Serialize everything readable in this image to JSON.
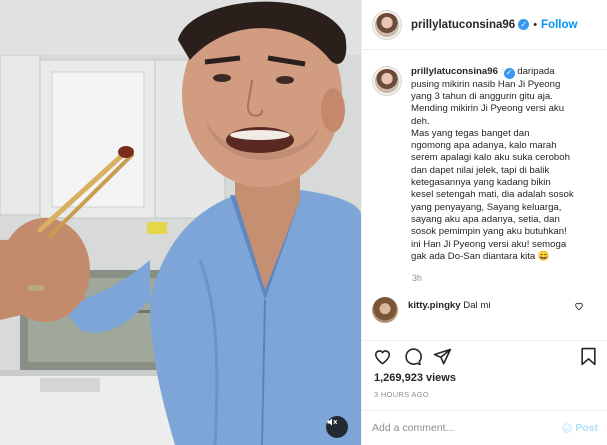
{
  "post": {
    "username": "prillylatuconsina96",
    "follow_label": "Follow",
    "separator": "•",
    "verified_mark": "✓"
  },
  "caption": {
    "username": "prillylatuconsina96",
    "lines": [
      "daripada",
      "pusing mikirin nasib Han Ji Pyeong",
      "yang 3 tahun di anggurin gitu aja.",
      "Mending mikirin Ji Pyeong versi aku",
      "deh.",
      "Mas yang tegas banget dan",
      "ngomong apa adanya, kalo marah",
      "serem apalagi kalo aku suka ceroboh",
      "dan dapet nilai jelek, tapi di balik",
      "ketegasannya yang kadang bikin",
      "kesel setengah mati, dia adalah sosok",
      "yang penyayang, Sayang keluarga,",
      "sayang aku apa adanya, setia, dan",
      "sosok pemimpin yang aku butuhkan!",
      "ini Han Ji Pyeong versi aku! semoga",
      "gak ada Do-San diantara kita 😄"
    ],
    "time": "3h"
  },
  "comment": {
    "username": "kitty.pingky",
    "text": "Dal mi"
  },
  "stats": {
    "views": "1,269,923 views",
    "time_ago": "3 HOURS AGO"
  },
  "composer": {
    "placeholder": "Add a comment...",
    "post_label": "Post"
  },
  "icons": {
    "like": "heart-icon",
    "comment": "comment-icon",
    "share": "share-icon",
    "save": "bookmark-icon",
    "audio": "speaker-icon",
    "emoji": "emoji-icon"
  },
  "colors": {
    "link_blue": "#0095f6",
    "verified_blue": "#3897f0",
    "muted_text": "#8e8e8e",
    "post_disabled": "#b2dffc",
    "shirt_blue": "#7ea5d8"
  }
}
